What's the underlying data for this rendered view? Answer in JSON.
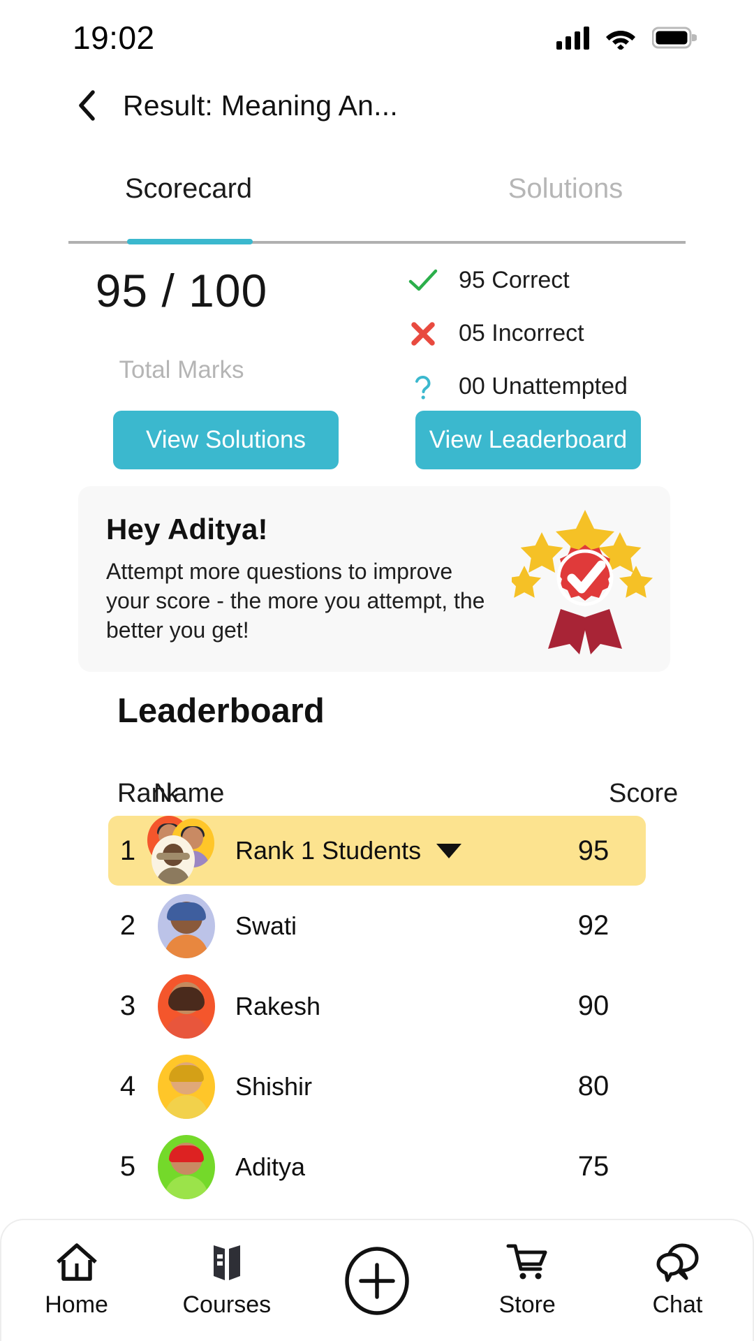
{
  "statusbar": {
    "time": "19:02",
    "signal_icon": "cellular-signal-icon",
    "wifi_icon": "wifi-icon",
    "battery_icon": "battery-full-icon"
  },
  "header": {
    "back_icon": "chevron-left-icon",
    "title": "Result: Meaning An..."
  },
  "tabs": [
    {
      "label": "Scorecard",
      "active": true
    },
    {
      "label": "Solutions",
      "active": false
    }
  ],
  "score": {
    "value": "95 / 100",
    "caption": "Total Marks",
    "stats": [
      {
        "icon": "check-icon",
        "count": "95",
        "label": "Correct",
        "color": "#2BAF4B"
      },
      {
        "icon": "cross-icon",
        "count": "05",
        "label": "Incorrect",
        "color": "#E84A3F"
      },
      {
        "icon": "question-icon",
        "count": "00",
        "label": "Unattempted",
        "color": "#3BB8CE"
      }
    ]
  },
  "actions": {
    "view_solutions": "View Solutions",
    "view_leaderboard": "View Leaderboard",
    "accent_color": "#3BB8CE"
  },
  "promo_card": {
    "title": "Hey Aditya!",
    "body": "Attempt more questions to improve your score - the more you attempt, the better you get!",
    "art_icon": "award-badge-icon",
    "background": "#F8F8F8",
    "badge_color": "#E03A3A",
    "star_color": "#F5C126"
  },
  "leaderboard": {
    "title": "Leaderboard",
    "columns": {
      "rank": "Rank",
      "name": "Name",
      "score": "Score"
    },
    "highlight_color": "#FCE38F",
    "rows": [
      {
        "rank": "1",
        "name": "Rank 1 Students",
        "score": "95",
        "highlighted": true,
        "avatar": "group-avatar",
        "expand_icon": "caret-down-icon"
      },
      {
        "rank": "2",
        "name": "Swati",
        "score": "92",
        "highlighted": false,
        "avatar": "avatar-swati",
        "bg": "#BCC3E8",
        "hair": "#3E5E9E",
        "skin": "#8A5A3B",
        "body": "#E8873F"
      },
      {
        "rank": "3",
        "name": "Rakesh",
        "score": "90",
        "highlighted": false,
        "avatar": "avatar-rakesh",
        "bg": "#F4562C",
        "hair": "#4A2A1C",
        "skin": "#C58A5E",
        "body": "#E8563C"
      },
      {
        "rank": "4",
        "name": "Shishir",
        "score": "80",
        "highlighted": false,
        "avatar": "avatar-shishir",
        "bg": "#FFC629",
        "hair": "#D4A017",
        "skin": "#E0A878",
        "body": "#F2D14B"
      },
      {
        "rank": "5",
        "name": "Aditya",
        "score": "75",
        "highlighted": false,
        "avatar": "avatar-aditya",
        "bg": "#74D92A",
        "hair": "#DD2222",
        "skin": "#C98A63",
        "body": "#9BE34A"
      }
    ]
  },
  "bottom_nav": [
    {
      "label": "Home",
      "icon": "home-icon"
    },
    {
      "label": "Courses",
      "icon": "book-icon"
    },
    {
      "label": "",
      "icon": "plus-circle-icon"
    },
    {
      "label": "Store",
      "icon": "cart-icon"
    },
    {
      "label": "Chat",
      "icon": "chat-bubbles-icon"
    }
  ]
}
